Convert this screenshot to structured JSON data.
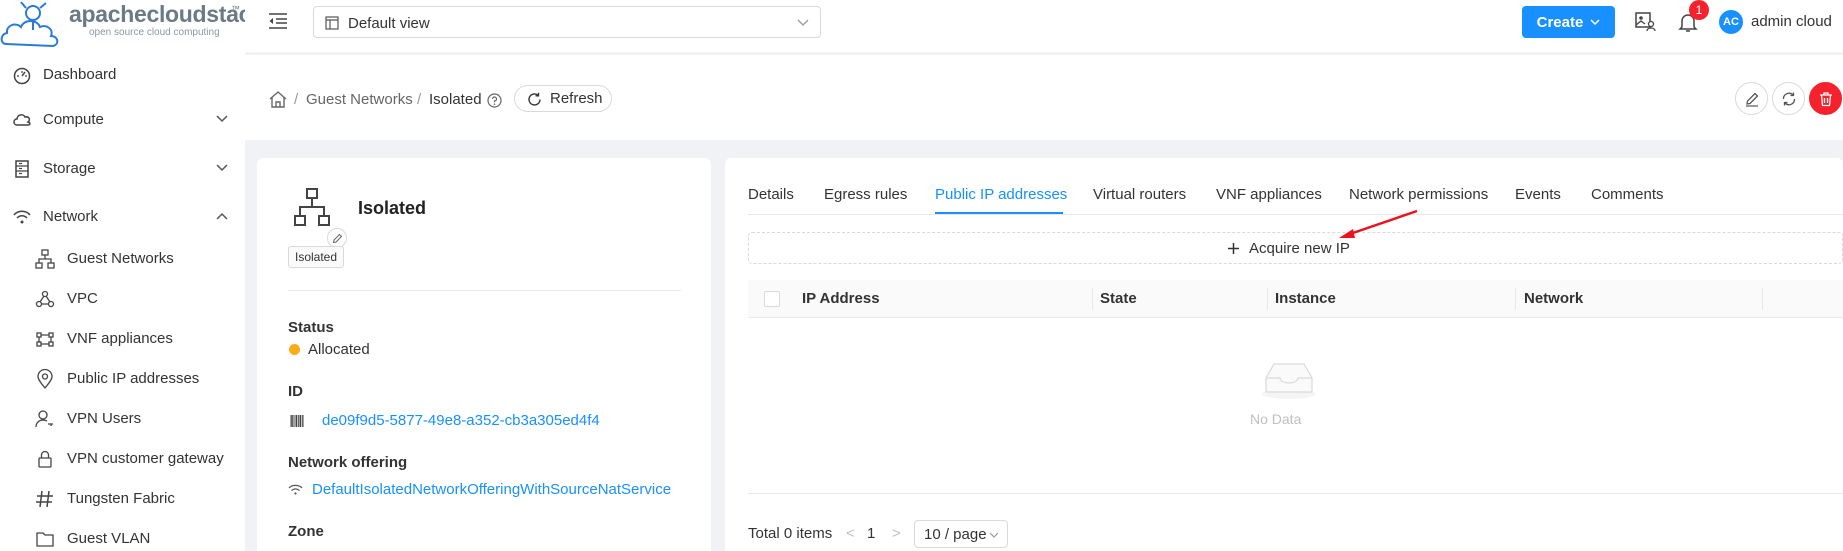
{
  "app": {
    "logo_text": "apachecloudstack",
    "logo_tagline": "open source cloud computing",
    "logo_tm": "™"
  },
  "sidebar": {
    "items": [
      {
        "label": "Dashboard",
        "icon": "dashboard-icon"
      },
      {
        "label": "Compute",
        "icon": "cloud-icon",
        "expandable": true,
        "expanded": false
      },
      {
        "label": "Storage",
        "icon": "database-icon",
        "expandable": true,
        "expanded": false
      },
      {
        "label": "Network",
        "icon": "wifi-icon",
        "expandable": true,
        "expanded": true
      }
    ],
    "network_sub": [
      {
        "label": "Guest Networks",
        "icon": "network-tree-icon"
      },
      {
        "label": "VPC",
        "icon": "vpc-icon"
      },
      {
        "label": "VNF appliances",
        "icon": "vnf-icon"
      },
      {
        "label": "Public IP addresses",
        "icon": "location-pin-icon"
      },
      {
        "label": "VPN Users",
        "icon": "user-key-icon"
      },
      {
        "label": "VPN customer gateway",
        "icon": "lock-icon"
      },
      {
        "label": "Tungsten Fabric",
        "icon": "hash-icon"
      },
      {
        "label": "Guest VLAN",
        "icon": "folder-icon"
      }
    ]
  },
  "header": {
    "view_select": "Default view",
    "create_label": "Create",
    "notification_count": "1",
    "avatar_initials": "AC",
    "username": "admin cloud"
  },
  "breadcrumb": {
    "sep": "/",
    "parent": "Guest Networks",
    "current": "Isolated",
    "refresh_label": "Refresh"
  },
  "details": {
    "name": "Isolated",
    "type_tag": "Isolated",
    "status_label": "Status",
    "status_value": "Allocated",
    "status_color": "#faad14",
    "id_label": "ID",
    "id_value": "de09f9d5-5877-49e8-a352-cb3a305ed4f4",
    "offering_label": "Network offering",
    "offering_value": "DefaultIsolatedNetworkOfferingWithSourceNatService",
    "zone_label": "Zone"
  },
  "tabs": [
    {
      "label": "Details",
      "active": false
    },
    {
      "label": "Egress rules",
      "active": false
    },
    {
      "label": "Public IP addresses",
      "active": true
    },
    {
      "label": "Virtual routers",
      "active": false
    },
    {
      "label": "VNF appliances",
      "active": false
    },
    {
      "label": "Network permissions",
      "active": false
    },
    {
      "label": "Events",
      "active": false
    },
    {
      "label": "Comments",
      "active": false
    }
  ],
  "ip_table": {
    "acquire_label": "Acquire new IP",
    "columns": [
      "IP Address",
      "State",
      "Instance",
      "Network"
    ],
    "rows": [],
    "empty_text": "No Data"
  },
  "pagination": {
    "total": "Total 0 items",
    "prev": "<",
    "page": "1",
    "next": ">",
    "page_size": "10 / page"
  },
  "colors": {
    "accent": "#1890ff",
    "danger": "#f5222d",
    "annotation_arrow": "#e8141e"
  }
}
